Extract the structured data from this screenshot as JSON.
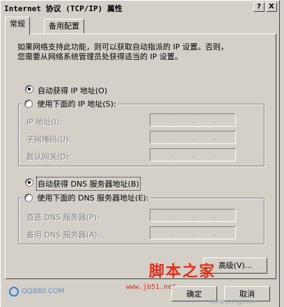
{
  "window": {
    "title": "Internet 协议 (TCP/IP) 属性",
    "help_button": "?",
    "close_button": "X"
  },
  "tabs": [
    {
      "label": "常规",
      "active": true
    },
    {
      "label": "备用配置",
      "active": false
    }
  ],
  "description": [
    "如果网络支持此功能，则可以获取自动指派的 IP 设置。否则，",
    "您需要从网络系统管理员处获得适当的 IP 设置。"
  ],
  "ip_section": {
    "auto_radio": {
      "label": "自动获得 IP 地址(O)",
      "checked": true
    },
    "manual_radio": {
      "label": "使用下面的 IP 地址(S):",
      "checked": false
    },
    "fields": [
      {
        "label": "IP 地址(I):",
        "value": ". . ."
      },
      {
        "label": "子网掩码(U):",
        "value": ". . ."
      },
      {
        "label": "默认网关(D):",
        "value": ". . ."
      }
    ]
  },
  "dns_section": {
    "auto_radio": {
      "label": "自动获得 DNS 服务器地址(B)",
      "checked": true
    },
    "manual_radio": {
      "label": "使用下面的 DNS 服务器地址(E):",
      "checked": false
    },
    "fields": [
      {
        "label": "首选 DNS 服务器(P):",
        "value": ". . ."
      },
      {
        "label": "备用 DNS 服务器(A):",
        "value": ". . ."
      }
    ]
  },
  "buttons": {
    "advanced": "高级(V)...",
    "ok": "确定",
    "cancel": "取消"
  },
  "watermarks": {
    "jb51_title": "脚本之家",
    "jb51_url": "www.jb51.net",
    "qq": "QQ880.COM",
    "side": "www.pongcom"
  },
  "colors": {
    "face": "#d4d0c8",
    "watermark_red": "#e0301c",
    "qq_blue": "#3a7bd5"
  }
}
